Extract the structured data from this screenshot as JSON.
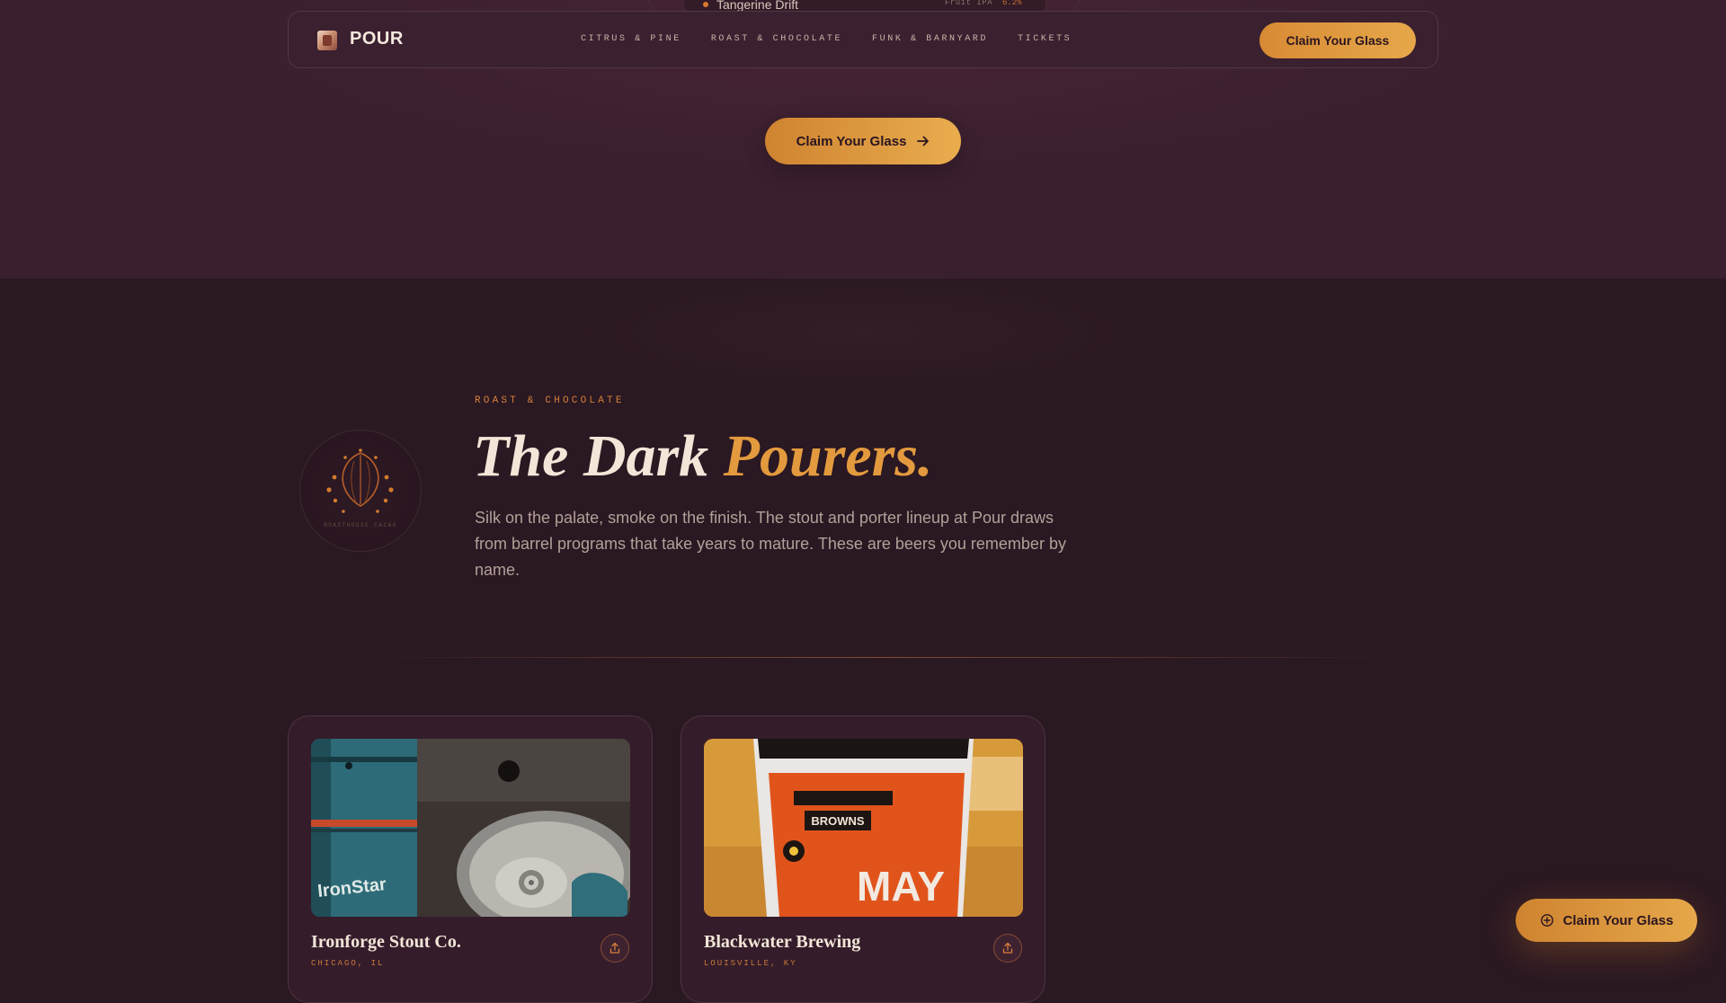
{
  "peek_item": {
    "name": "Tangerine Drift",
    "style": "Fruit IPA",
    "abv": "6.2%"
  },
  "nav": {
    "brand": "POUR",
    "links": [
      "CITRUS & PINE",
      "ROAST & CHOCOLATE",
      "FUNK & BARNYARD",
      "TICKETS"
    ],
    "cta_label": "Claim Your Glass"
  },
  "hero": {
    "cta_label": "Claim Your Glass"
  },
  "section": {
    "eyebrow": "ROAST & CHOCOLATE",
    "headline_main": "The Dark ",
    "headline_accent": "Pourers.",
    "lede": "Silk on the palate, smoke on the finish. The stout and porter lineup at Pour draws from barrel programs that take years to mature. These are beers you remember by name.",
    "badge_text": "ROASTHOUSE CACAO"
  },
  "breweries": [
    {
      "name": "Ironforge Stout Co.",
      "location": "CHICAGO, IL",
      "image_text": "IronStar"
    },
    {
      "name": "Blackwater Brewing",
      "location": "LOUISVILLE, KY",
      "image_text_1": "BROWNS",
      "image_text_2": "MAY"
    }
  ],
  "floating_cta": {
    "label": "Claim Your Glass"
  },
  "colors": {
    "background": "#2a1822",
    "band": "#3a1f2e",
    "accent": "#e39a3e",
    "accent_deep": "#d6803a",
    "text": "#f3e6d8",
    "muted": "#b3a099"
  },
  "icons": [
    "logo-icon",
    "arrow-right-icon",
    "cacao-pod-icon",
    "share-icon",
    "plus-circle-icon"
  ]
}
